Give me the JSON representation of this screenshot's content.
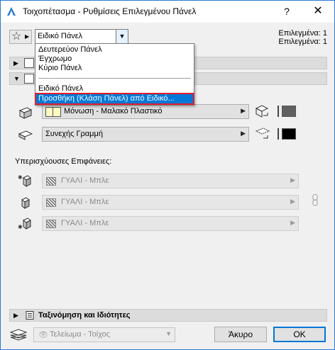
{
  "window": {
    "title": "Τοιχοπέτασμα - Ρυθμίσεις Επιλεγμένου Πάνελ",
    "help_label": "?",
    "close_label": "✕"
  },
  "header": {
    "favorites_icon": "star-icon",
    "combo_value": "Ειδικό Πάνελ",
    "selected_line1": "Επιλεγμένα: 1",
    "selected_line2": "Επιλεγμένα: 1"
  },
  "dropdown": {
    "items": [
      "Δευτερεύον Πάνελ",
      "Έγχρωμο",
      "Κύριο Πάνελ",
      "Ειδικό Πάνελ"
    ],
    "action": "Προσθήκη (Κλάση Πάνελ) από Ειδικό..."
  },
  "surfaces": {
    "material_row": "Μόνωση - Μαλακό Πλαστικό",
    "line_row": "Συνεχής Γραμμή",
    "override_label": "Υπερισχύουσες Επιφάνειες:",
    "override_1": "ΓΥΑΛΙ - Μπλε",
    "override_2": "ΓΥΑΛΙ - Μπλε",
    "override_3": "ΓΥΑΛΙ - Μπλε"
  },
  "footer": {
    "section_label": "Ταξινόμηση και Ιδιότητες",
    "layer_value": "Τελείωμα - Τοίχος",
    "cancel_label": "Άκυρο",
    "ok_label": "OK"
  },
  "colors": {
    "accent": "#0078d7",
    "highlight_border": "#e0202a",
    "swatch_yellow": "#fff9c4"
  }
}
